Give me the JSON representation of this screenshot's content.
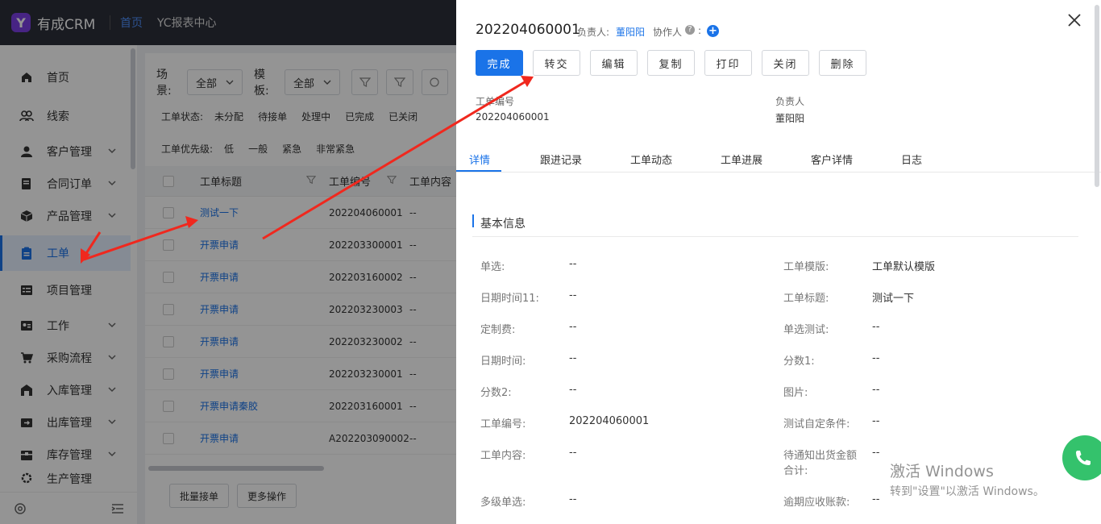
{
  "topbar": {
    "logo_mark": "Y",
    "logo_text": "有成CRM",
    "nav": [
      "首页",
      "YC报表中心"
    ]
  },
  "sidebar": {
    "items": [
      {
        "label": "首页",
        "icon": "home-icon",
        "chevron": false
      },
      {
        "label": "线索",
        "icon": "users-icon",
        "chevron": false
      },
      {
        "label": "客户管理",
        "icon": "user-icon",
        "chevron": true
      },
      {
        "label": "合同订单",
        "icon": "contract-icon",
        "chevron": true
      },
      {
        "label": "产品管理",
        "icon": "cube-icon",
        "chevron": true
      },
      {
        "label": "工单",
        "icon": "clipboard-icon",
        "chevron": false,
        "active": true
      },
      {
        "label": "项目管理",
        "icon": "project-icon",
        "chevron": false
      },
      {
        "label": "工作",
        "icon": "card-icon",
        "chevron": true
      },
      {
        "label": "采购流程",
        "icon": "cart-icon",
        "chevron": true
      },
      {
        "label": "入库管理",
        "icon": "warehouse-in-icon",
        "chevron": true
      },
      {
        "label": "出库管理",
        "icon": "warehouse-out-icon",
        "chevron": true
      },
      {
        "label": "库存管理",
        "icon": "box-icon",
        "chevron": true
      },
      {
        "label": "生产管理",
        "icon": "gear-icon",
        "chevron": true
      }
    ]
  },
  "list": {
    "scene_label": "场景:",
    "scene_value": "全部",
    "template_label": "模板:",
    "template_value": "全部",
    "status_label": "工单状态:",
    "statuses": [
      "未分配",
      "待接单",
      "处理中",
      "已完成",
      "已关闭"
    ],
    "priority_label": "工单优先级:",
    "priorities": [
      "低",
      "一般",
      "紧急",
      "非常紧急"
    ],
    "columns": [
      "工单标题",
      "工单编号",
      "工单内容"
    ],
    "rows": [
      {
        "title": "测试一下",
        "no": "202204060001",
        "content": "--"
      },
      {
        "title": "开票申请",
        "no": "202203300001",
        "content": "--"
      },
      {
        "title": "开票申请",
        "no": "202203160002",
        "content": "--"
      },
      {
        "title": "开票申请",
        "no": "202203230003",
        "content": "--"
      },
      {
        "title": "开票申请",
        "no": "202203230002",
        "content": "--"
      },
      {
        "title": "开票申请",
        "no": "202203230001",
        "content": "--"
      },
      {
        "title": "开票申请秦胶",
        "no": "202203160001",
        "content": "--"
      },
      {
        "title": "开票申请",
        "no": "A202203090002",
        "content": "--"
      }
    ],
    "batch_accept": "批量接单",
    "more_actions": "更多操作"
  },
  "drawer": {
    "title": "202204060001",
    "owner_label": "负责人:",
    "owner": "董阳阳",
    "collab_label": "协作人",
    "colon": ":",
    "actions": [
      "完成",
      "转交",
      "编辑",
      "复制",
      "打印",
      "关闭",
      "删除"
    ],
    "meta": {
      "no_label": "工单编号",
      "no_value": "202204060001",
      "owner_label": "负责人",
      "owner_value": "董阳阳"
    },
    "tabs": [
      "详情",
      "跟进记录",
      "工单动态",
      "工单进展",
      "客户详情",
      "日志"
    ],
    "section_title": "基本信息",
    "fields_left": [
      {
        "k": "单选:",
        "v": "--"
      },
      {
        "k": "日期时间11:",
        "v": "--"
      },
      {
        "k": "定制费:",
        "v": "--"
      },
      {
        "k": "日期时间:",
        "v": "--"
      },
      {
        "k": "分数2:",
        "v": "--"
      },
      {
        "k": "工单编号:",
        "v": "202204060001"
      },
      {
        "k": "工单内容:",
        "v": "--"
      },
      {
        "k": "多级单选:",
        "v": "--"
      }
    ],
    "fields_right": [
      {
        "k": "工单模版:",
        "v": "工单默认模版"
      },
      {
        "k": "工单标题:",
        "v": "测试一下"
      },
      {
        "k": "单选测试:",
        "v": "--"
      },
      {
        "k": "分数1:",
        "v": "--"
      },
      {
        "k": "图片:",
        "v": "--"
      },
      {
        "k": "测试自定条件:",
        "v": "--"
      },
      {
        "k": "待通知出货金额合计:",
        "v": "--"
      },
      {
        "k": "逾期应收账款:",
        "v": "--"
      }
    ]
  },
  "watermark": {
    "line1": "激活 Windows",
    "line2": "转到\"设置\"以激活 Windows。"
  },
  "colors": {
    "accent": "#1a73e8",
    "arrow": "#f0281e",
    "brand": "#7b3fe4"
  }
}
